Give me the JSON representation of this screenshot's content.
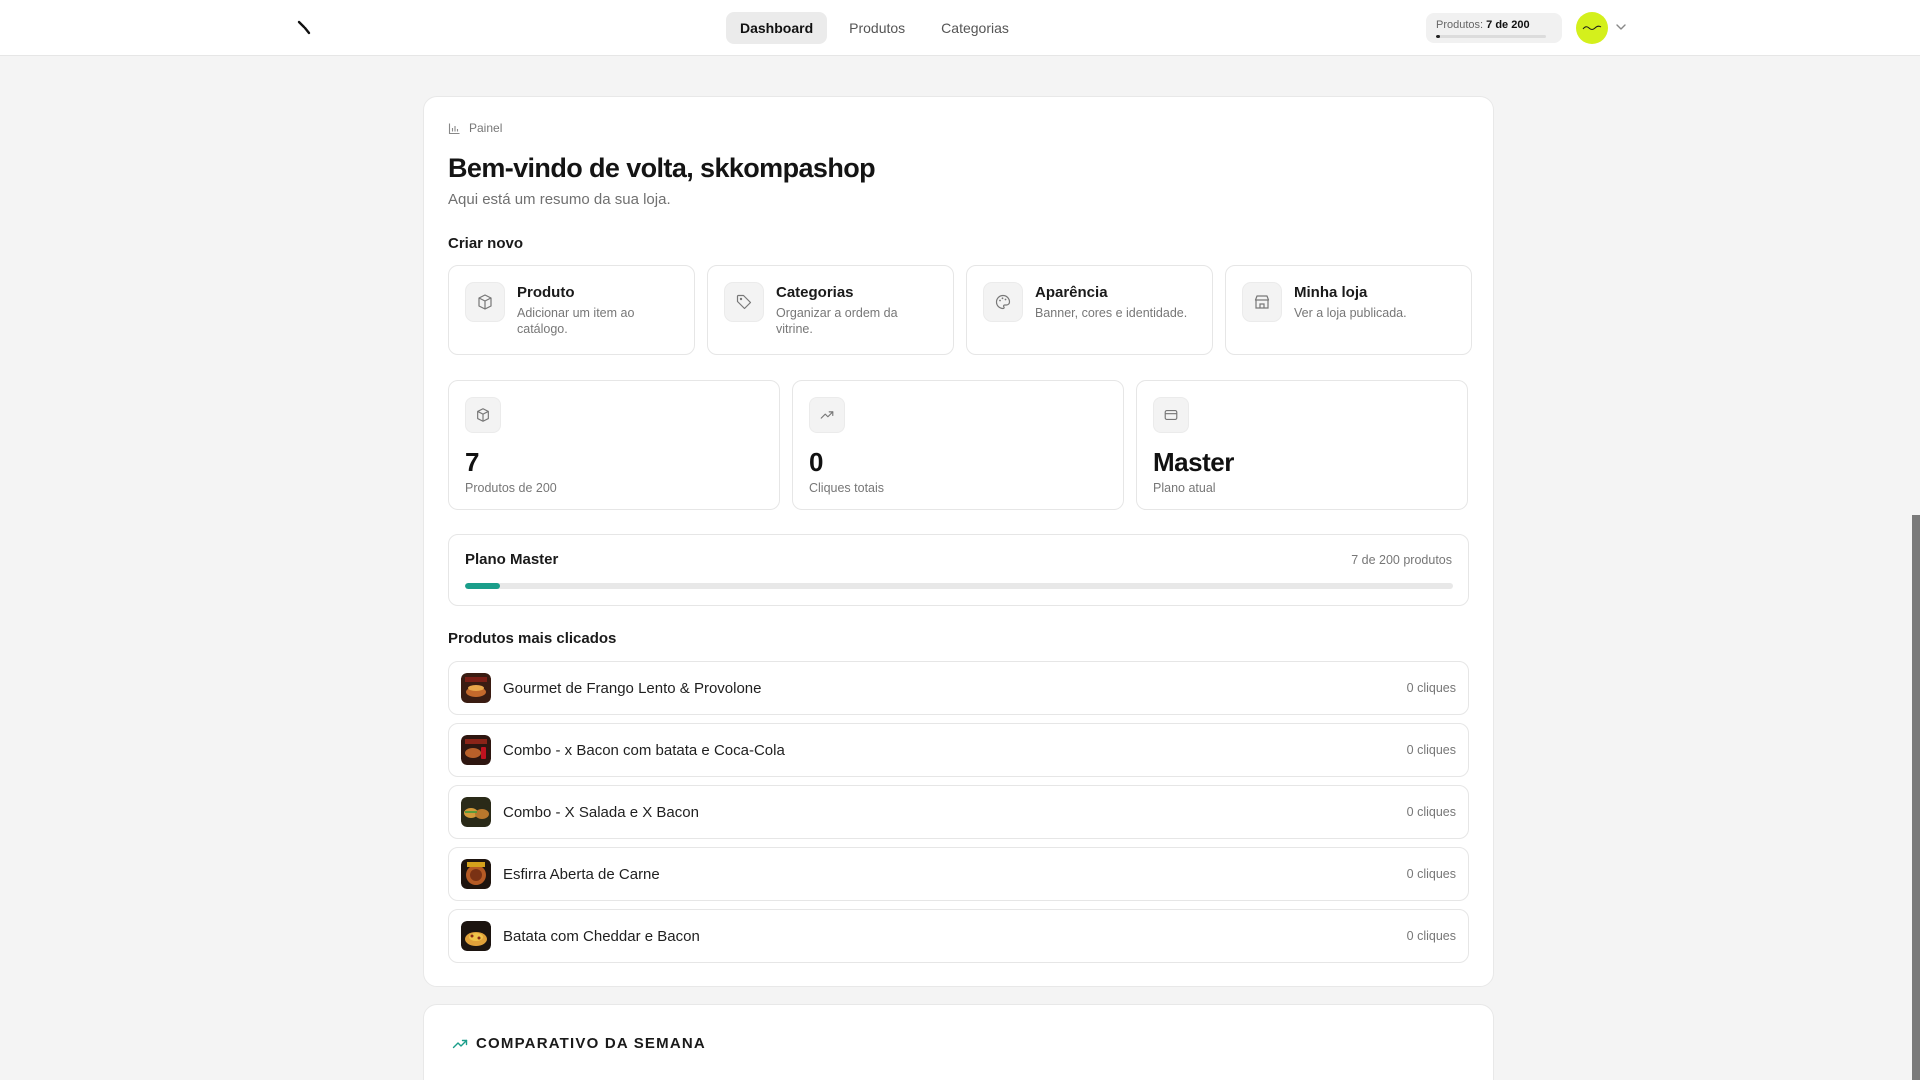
{
  "nav": {
    "items": [
      {
        "label": "Dashboard",
        "active": true
      },
      {
        "label": "Produtos",
        "active": false
      },
      {
        "label": "Categorias",
        "active": false
      }
    ]
  },
  "quota": {
    "label": "Produtos:",
    "value": "7 de 200",
    "used": 7,
    "total": 200
  },
  "breadcrumb": "Painel",
  "header": {
    "title": "Bem-vindo de volta, skkompashop",
    "subtitle": "Aqui está um resumo da sua loja."
  },
  "create_new": {
    "label": "Criar novo",
    "cards": [
      {
        "icon": "box-icon",
        "title": "Produto",
        "desc": "Adicionar um item ao catálogo."
      },
      {
        "icon": "tag-icon",
        "title": "Categorias",
        "desc": "Organizar a ordem da vitrine."
      },
      {
        "icon": "palette-icon",
        "title": "Aparência",
        "desc": "Banner, cores e identidade."
      },
      {
        "icon": "store-icon",
        "title": "Minha loja",
        "desc": "Ver a loja publicada."
      }
    ]
  },
  "stats": [
    {
      "icon": "box-icon",
      "value": "7",
      "label": "Produtos de 200"
    },
    {
      "icon": "trending-up-icon",
      "value": "0",
      "label": "Cliques totais"
    },
    {
      "icon": "credit-card-icon",
      "value": "Master",
      "label": "Plano atual"
    }
  ],
  "plan": {
    "title": "Plano Master",
    "count": "7 de 200 produtos",
    "used": 7,
    "total": 200
  },
  "top_products": {
    "label": "Produtos mais clicados",
    "items": [
      {
        "name": "Gourmet de Frango Lento & Provolone",
        "clicks": "0 cliques"
      },
      {
        "name": "Combo - x Bacon com batata e Coca-Cola",
        "clicks": "0 cliques"
      },
      {
        "name": "Combo - X Salada e X Bacon",
        "clicks": "0 cliques"
      },
      {
        "name": "Esfirra Aberta de Carne",
        "clicks": "0 cliques"
      },
      {
        "name": "Batata com Cheddar e Bacon",
        "clicks": "0 cliques"
      }
    ]
  },
  "weekly": {
    "title": "COMPARATIVO DA SEMANA"
  },
  "colors": {
    "accent": "#1a9e8a",
    "avatar": "#d4f01c"
  }
}
